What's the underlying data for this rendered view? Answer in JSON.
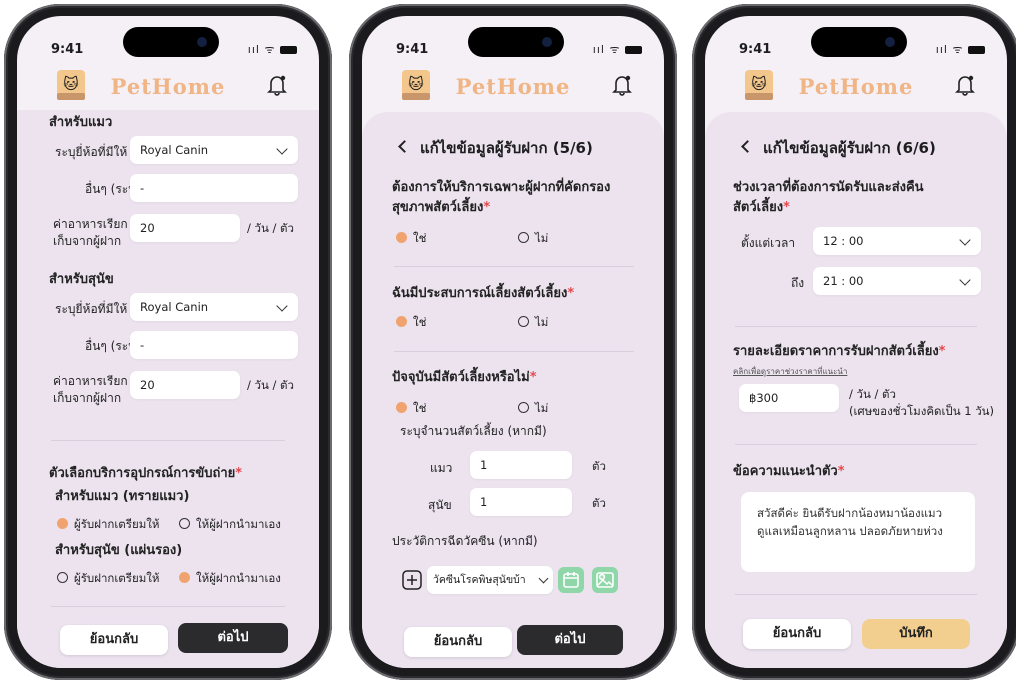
{
  "status": {
    "time": "9:41",
    "signal": "ııl ᯤ"
  },
  "app": {
    "brand": "PetHome"
  },
  "screen1": {
    "cat_section": "สำหรับแมว",
    "brand_label": "ระบุยี่ห้อที่มีให้",
    "brand_value": "Royal Canin",
    "other_label": "อื่นๆ (ระบุ)",
    "other_value": "-",
    "fee_label_1": "ค่าอาหารเรียก",
    "fee_label_2": "เก็บจากผู้ฝาก",
    "fee_value": "20",
    "fee_unit": "/ วัน / ตัว",
    "dog_section": "สำหรับสุนัข",
    "dog_brand_value": "Royal Canin",
    "dog_other_value": "-",
    "dog_fee_value": "20",
    "toilet_question": "ตัวเลือกบริการอุปกรณ์การขับถ่าย",
    "toilet_cat": "สำหรับแมว (ทรายแมว)",
    "toilet_dog": "สำหรับสุนัข (แผ่นรอง)",
    "opt_provider": "ผู้รับฝากเตรียมให้",
    "opt_owner": "ให้ผู้ฝากนำมาเอง",
    "back_btn": "ย้อนกลับ",
    "next_btn": "ต่อไป"
  },
  "screen2": {
    "title": "แก้ไขข้อมูลผู้รับฝาก (5/6)",
    "q1_l1": "ต้องการให้บริการเฉพาะผู้ฝากที่คัดกรอง",
    "q1_l2": "สุขภาพสัตว์เลี้ยง",
    "q2": "ฉันมีประสบการณ์เลี้ยงสัตว์เลี้ยง",
    "q3": "ปัจจุบันมีสัตว์เลี้ยงหรือไม่",
    "yes": "ใช่",
    "no": "ไม่",
    "count_label": "ระบุจำนวนสัตว์เลี้ยง (หากมี)",
    "cat_label": "แมว",
    "cat_count": "1",
    "dog_label": "สุนัข",
    "dog_count": "1",
    "count_unit": "ตัว",
    "vaccine_label": "ประวัติการฉีดวัคซีน (หากมี)",
    "vaccine_value": "วัคซีนโรคพิษสุนัขบ้า",
    "back_btn": "ย้อนกลับ",
    "next_btn": "ต่อไป"
  },
  "screen3": {
    "title": "แก้ไขข้อมูลผู้รับฝาก (6/6)",
    "q1_l1": "ช่วงเวลาที่ต้องการนัดรับและส่งคืน",
    "q1_l2": "สัตว์เลี้ยง",
    "from_label": "ตั้งแต่เวลา",
    "from_value": "12 : 00",
    "to_label": "ถึง",
    "to_value": "21 : 00",
    "price_question": "รายละเอียดราคาการรับฝากสัตว์เลี้ยง",
    "price_link": "คลิกเพื่อดูราคาช่วงราคาที่แนะนำ",
    "price_value": "฿300",
    "price_unit_1": "/ วัน / ตัว",
    "price_unit_2": "(เศษของชั่วโมงคิดเป็น 1 วัน)",
    "intro_question": "ข้อความแนะนำตัว",
    "intro_text_1": "สวัสดีค่ะ ยินดีรับฝากน้องหมาน้องแมว",
    "intro_text_2": "ดูแลเหมือนลูกหลาน ปลอดภัยหายห่วง",
    "back_btn": "ย้อนกลับ",
    "save_btn": "บันทึก"
  }
}
